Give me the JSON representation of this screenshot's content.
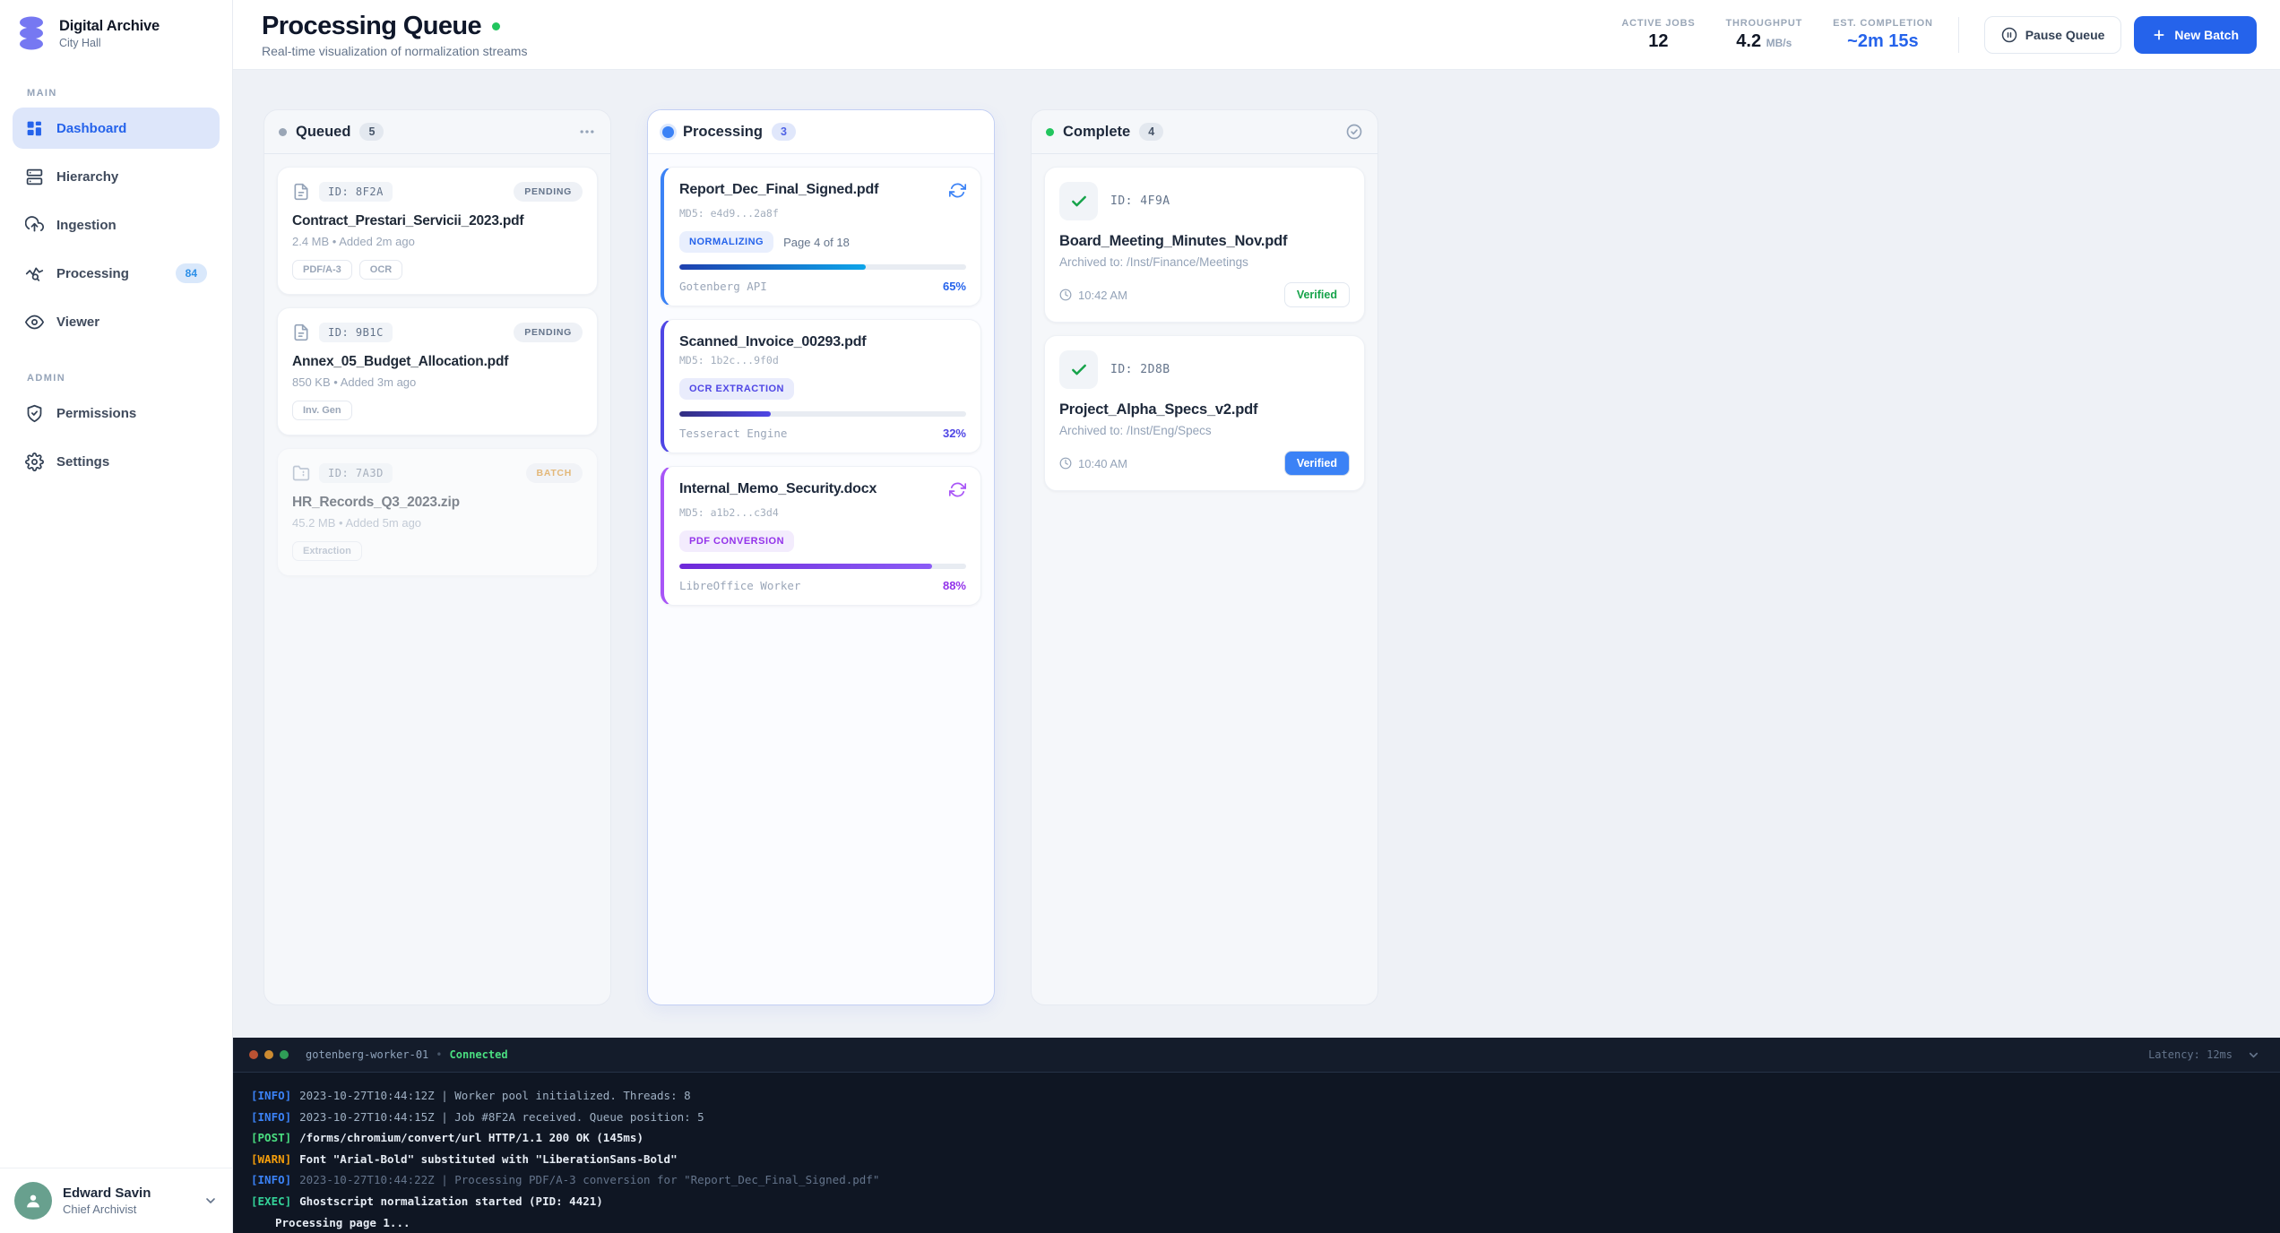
{
  "colors": {
    "accent": "#2563eb",
    "brand_logo": "#7678f2",
    "success": "#22c55e",
    "verified_green": "#16a34a",
    "batch_amber": "#d58511",
    "processing_blue": "#3b82f6",
    "processing_indigo": "#4f46e5",
    "processing_purple": "#a855f7",
    "terminal_bg": "#0f1623",
    "selection_blue": "#3b82f6"
  },
  "sidebar": {
    "brand": {
      "title": "Digital Archive",
      "subtitle": "City Hall"
    },
    "main_label": "MAIN",
    "admin_label": "ADMIN",
    "items": {
      "dashboard": "Dashboard",
      "hierarchy": "Hierarchy",
      "ingestion": "Ingestion",
      "processing": "Processing",
      "processing_badge": "84",
      "viewer": "Viewer",
      "permissions": "Permissions",
      "settings": "Settings"
    },
    "user": {
      "name": "Edward Savin",
      "role": "Chief Archivist"
    }
  },
  "header": {
    "title": "Processing Queue",
    "subtitle": "Real-time visualization of normalization streams",
    "stats": [
      {
        "label": "ACTIVE JOBS",
        "value": "12",
        "unit": ""
      },
      {
        "label": "THROUGHPUT",
        "value": "4.2",
        "unit": "MB/s"
      },
      {
        "label": "EST. COMPLETION",
        "value": "~2m 15s",
        "unit": ""
      }
    ],
    "buttons": {
      "pause": "Pause Queue",
      "new_batch": "New Batch"
    }
  },
  "board": {
    "queued": {
      "title": "Queued",
      "count": "5",
      "cards": [
        {
          "id_label": "ID: 8F2A",
          "status": "PENDING",
          "title": "Contract_Prestari_Servicii_2023.pdf",
          "meta": "2.4 MB • Added 2m ago",
          "tags": [
            "PDF/A-3",
            "OCR"
          ]
        },
        {
          "id_label": "ID: 9B1C",
          "status": "PENDING",
          "title": "Annex_05_Budget_Allocation.pdf",
          "meta": "850 KB • Added 3m ago",
          "tags": [
            "Inv. Gen"
          ]
        },
        {
          "id_label": "ID: 7A3D",
          "status": "BATCH",
          "title": "HR_Records_Q3_2023.zip",
          "meta": "45.2 MB • Added 5m ago",
          "tags": [
            "Extraction"
          ]
        }
      ]
    },
    "processing": {
      "title": "Processing",
      "count": "3",
      "cards": [
        {
          "title": "Report_Dec_Final_Signed.pdf",
          "md5": "MD5: e4d9...2a8f",
          "stage": "NORMALIZING",
          "stage_extra": "Page 4 of 18",
          "worker": "Gotenberg API",
          "percent": "65%",
          "progress": 65
        },
        {
          "title": "Scanned_Invoice_00293.pdf",
          "md5": "MD5: 1b2c...9f0d",
          "stage": "OCR EXTRACTION",
          "stage_extra": "",
          "worker": "Tesseract Engine",
          "percent": "32%",
          "progress": 32
        },
        {
          "title": "Internal_Memo_Security.docx",
          "md5": "MD5: a1b2...c3d4",
          "stage": "PDF CONVERSION",
          "stage_extra": "",
          "worker": "LibreOffice Worker",
          "percent": "88%",
          "progress": 88
        }
      ]
    },
    "complete": {
      "title": "Complete",
      "count": "4",
      "cards": [
        {
          "id_label": "ID: 4F9A",
          "title": "Board_Meeting_Minutes_Nov.pdf",
          "archived": "Archived to: /Inst/Finance/Meetings",
          "time": "10:42 AM",
          "badge": "Verified"
        },
        {
          "id_label": "ID: 2D8B",
          "title": "Project_Alpha_Specs_v2.pdf",
          "archived": "Archived to: /Inst/Eng/Specs",
          "time": "10:40 AM",
          "badge": "Verified"
        }
      ]
    }
  },
  "terminal": {
    "host": "gotenberg-worker-01",
    "status": "Connected",
    "latency": "Latency: 12ms",
    "lines": [
      {
        "tag": "[INFO]",
        "text": "2023-10-27T10:44:12Z | Worker pool initialized. Threads: 8"
      },
      {
        "tag": "[INFO]",
        "text": "2023-10-27T10:44:15Z | Job #8F2A received. Queue position: 5"
      },
      {
        "tag": "[POST]",
        "text": "/forms/chromium/convert/url HTTP/1.1 200 OK (145ms)"
      },
      {
        "tag": "[WARN]",
        "text": "Font \"Arial-Bold\" substituted with \"LiberationSans-Bold\""
      },
      {
        "tag": "[INFO]",
        "text": "2023-10-27T10:44:22Z | Processing PDF/A-3 conversion for \"Report_Dec_Final_Signed.pdf\""
      },
      {
        "tag": "[EXEC]",
        "text": "Ghostscript normalization started (PID: 4421)"
      },
      {
        "tag": "",
        "text": "Processing page 1..."
      }
    ]
  }
}
